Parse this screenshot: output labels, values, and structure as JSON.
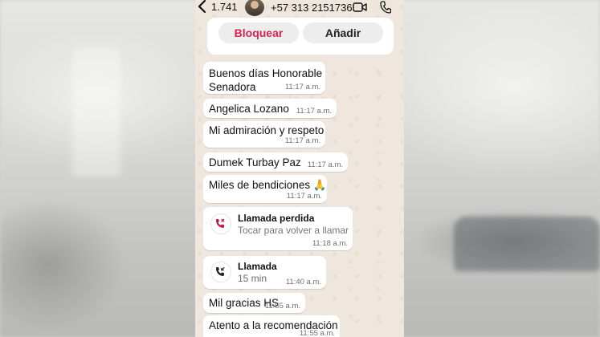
{
  "header": {
    "back_count": "1.741",
    "phone_number": "+57 313 2151736"
  },
  "contact_card": {
    "block_label": "Bloquear",
    "add_label": "Añadir"
  },
  "colors": {
    "block_text": "#d12552",
    "chat_background": "#efe7de",
    "missed_call_icon": "#c4184a"
  },
  "messages": [
    {
      "text_line1": "Buenos días Honorable",
      "text_line2": "Senadora",
      "time": "11:17 a.m."
    },
    {
      "text": "Angelica Lozano",
      "time": "11:17 a.m."
    },
    {
      "text": "Mi admiración y respeto",
      "time": "11:17 a.m."
    },
    {
      "text": "Dumek Turbay Paz",
      "time": "11:17 a.m."
    },
    {
      "text": "Miles de bendiciones 🙏",
      "time": "11:17 a.m."
    },
    {
      "type": "call",
      "icon": "missed-call-icon",
      "title": "Llamada perdida",
      "subtitle": "Tocar para volver a llamar",
      "time": "11:18 a.m."
    },
    {
      "type": "call",
      "icon": "incoming-call-icon",
      "title": "Llamada",
      "subtitle": "15 min",
      "time": "11:40 a.m."
    },
    {
      "text": "Mil gracias HS",
      "time": "11:55 a.m."
    },
    {
      "text": "Atento a la recomendación",
      "time": "11:55 a.m."
    }
  ]
}
